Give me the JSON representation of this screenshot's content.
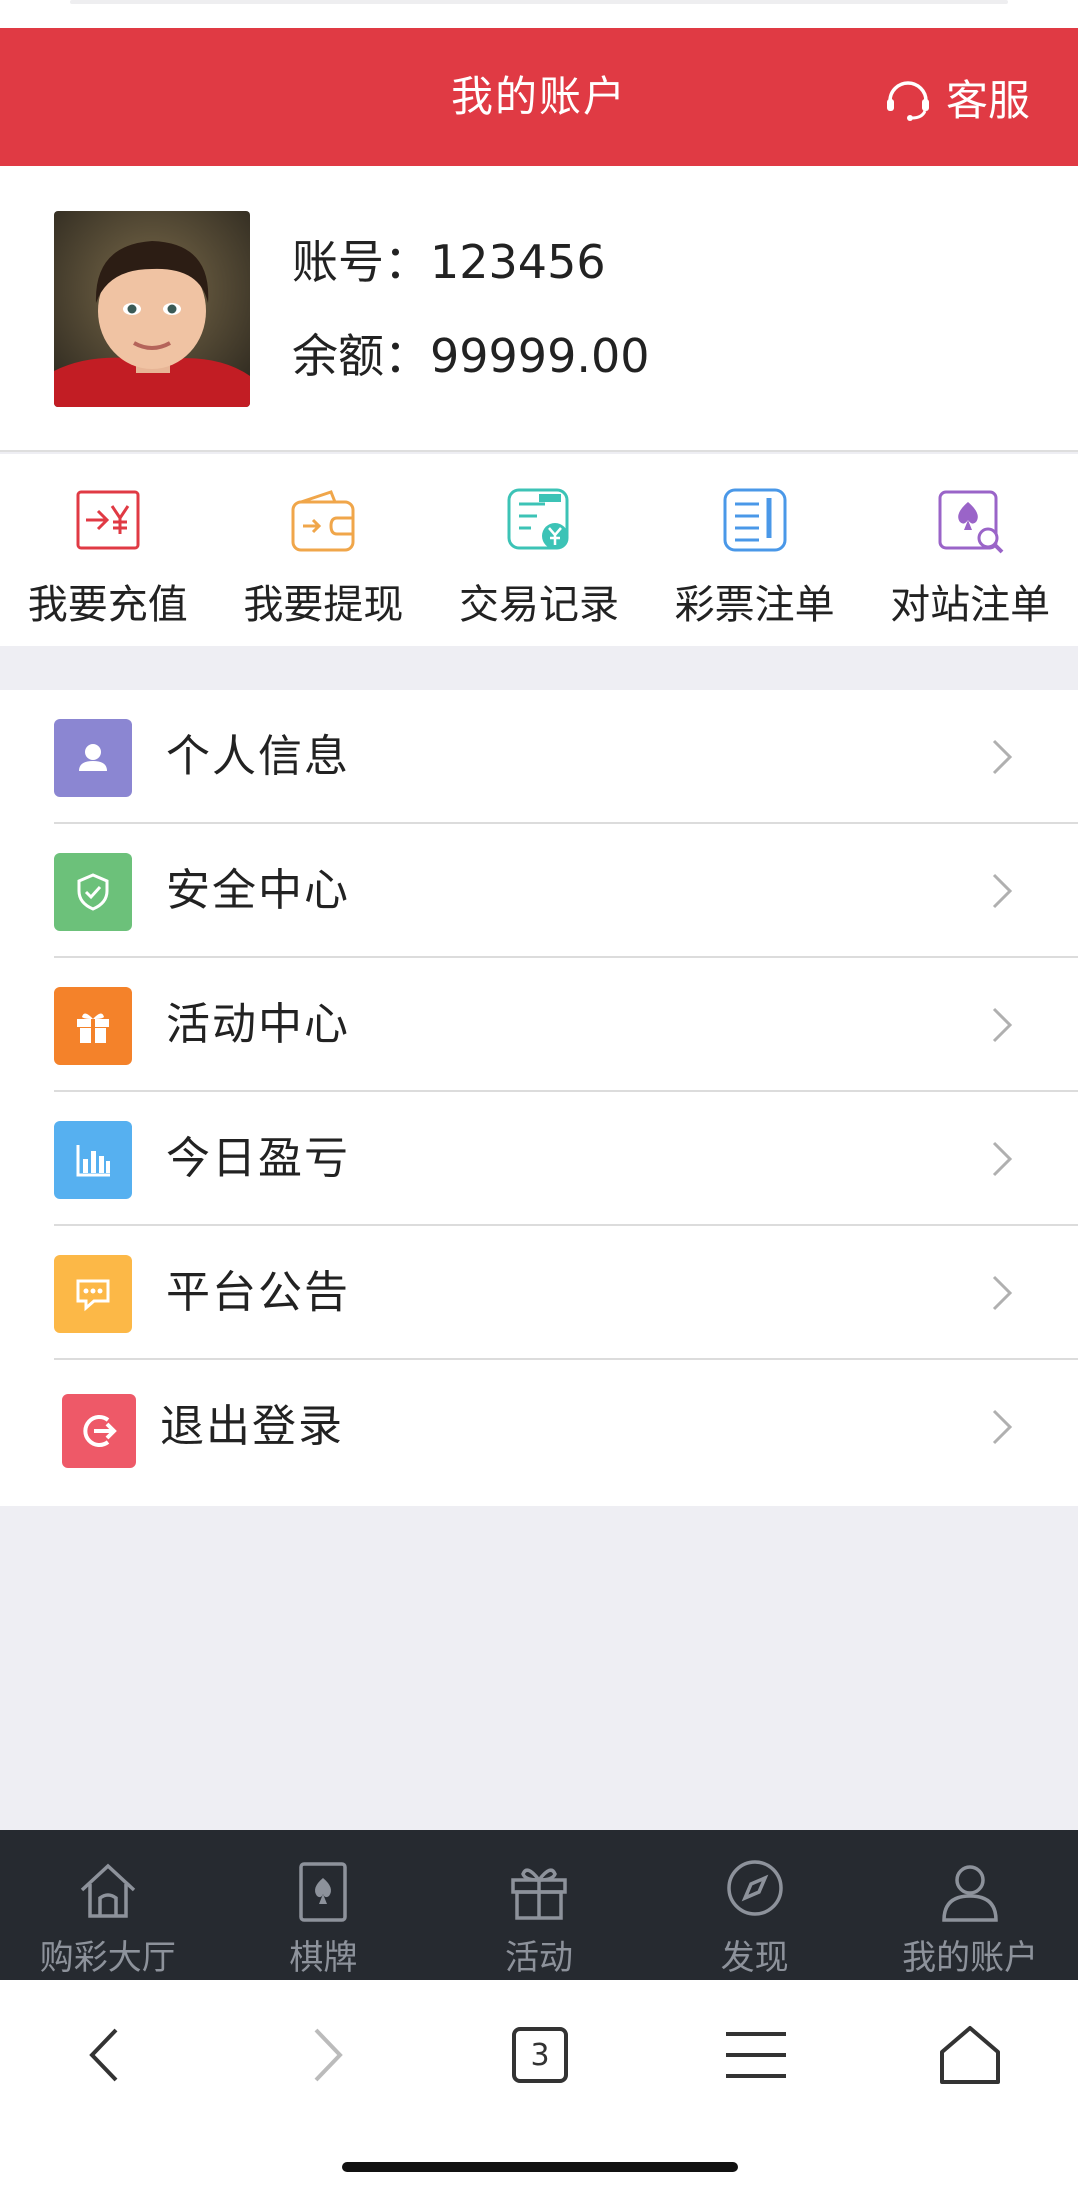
{
  "header": {
    "title": "我的账户",
    "service_label": "客服"
  },
  "account": {
    "account_label": "账号：",
    "account_value": "123456",
    "balance_label": "余额：",
    "balance_value": "99999.00"
  },
  "quick_actions": [
    {
      "label": "我要充值",
      "icon": "recharge-icon",
      "color": "#e03a44"
    },
    {
      "label": "我要提现",
      "icon": "wallet-icon",
      "color": "#f0a64a"
    },
    {
      "label": "交易记录",
      "icon": "transaction-record-icon",
      "color": "#3cc3b6"
    },
    {
      "label": "彩票注单",
      "icon": "lottery-order-icon",
      "color": "#4a98e8"
    },
    {
      "label": "对站注单",
      "icon": "versus-order-icon",
      "color": "#9a64c8"
    }
  ],
  "menu": [
    {
      "label": "个人信息",
      "icon": "person-icon",
      "color": "#8b86d2"
    },
    {
      "label": "安全中心",
      "icon": "shield-icon",
      "color": "#6cc17a"
    },
    {
      "label": "活动中心",
      "icon": "gift-icon",
      "color": "#f4822a"
    },
    {
      "label": "今日盈亏",
      "icon": "bar-chart-icon",
      "color": "#56b0f0"
    },
    {
      "label": "平台公告",
      "icon": "message-icon",
      "color": "#fcb847"
    },
    {
      "label": "退出登录",
      "icon": "logout-icon",
      "color": "#ee5968"
    }
  ],
  "tabbar": [
    {
      "label": "购彩大厅",
      "icon": "home-icon"
    },
    {
      "label": "棋牌",
      "icon": "cards-icon"
    },
    {
      "label": "活动",
      "icon": "gift-icon"
    },
    {
      "label": "发现",
      "icon": "compass-icon"
    },
    {
      "label": "我的账户",
      "icon": "user-icon"
    }
  ],
  "browser": {
    "tab_count": "3"
  }
}
